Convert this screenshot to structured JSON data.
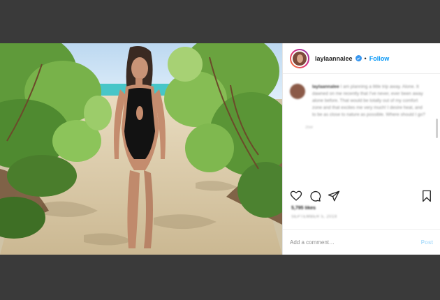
{
  "post": {
    "username": "laylaannalee",
    "separator": "•",
    "follow_label": "Follow",
    "caption_username": "laylaannalee",
    "caption_text": "I am planning a little trip away. Alone. It dawned on me recently that I've never, ever been away alone before. That would be totally out of my comfort zone and that excites me very much! I desire heat, and to be as close to nature as possible. Where should I go?",
    "caption_time": "35w",
    "likes": "5,795 likes",
    "date": "SEPTEMBER 5, 2019",
    "comment_placeholder": "Add a comment…",
    "post_label": "Post"
  },
  "icons": {
    "verified": "verified-badge-icon",
    "like": "heart-icon",
    "comment": "comment-bubble-icon",
    "share": "paper-plane-icon",
    "save": "bookmark-icon"
  },
  "colors": {
    "follow_blue": "#0095f6",
    "verified_blue": "#3897f0",
    "post_button_disabled": "#b2dffc",
    "frame_gray": "#3a3a3a"
  }
}
